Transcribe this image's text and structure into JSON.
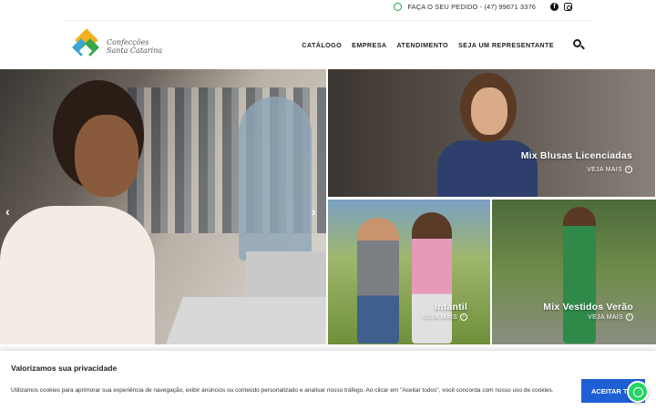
{
  "topbar": {
    "order_text": "FAÇA O SEU PEDIDO - (47) 99671 3376",
    "icons": [
      "whatsapp-icon",
      "facebook-icon",
      "instagram-icon"
    ]
  },
  "header": {
    "logo": {
      "line1": "Confecções",
      "line2": "Santa Catarina"
    },
    "nav": [
      {
        "label": "CATÁLOGO"
      },
      {
        "label": "EMPRESA"
      },
      {
        "label": "ATENDIMENTO"
      },
      {
        "label": "SEJA UM REPRESENTANTE"
      }
    ],
    "search_icon": "search-icon"
  },
  "hero": {
    "prev_arrow": "‹",
    "next_arrow": "›"
  },
  "tiles": [
    {
      "title": "Mix Blusas Licenciadas",
      "more": "VEJA MAIS"
    },
    {
      "title": "Infantil",
      "more": "VEJA MAIS"
    },
    {
      "title": "Mix Vestidos Verão",
      "more": "VEJA MAIS"
    }
  ],
  "cookie": {
    "title": "Valorizamos sua privacidade",
    "text": "Utilizamos cookies para aprimorar sua experiência de navegação, exibir anúncios ou conteúdo personalizado e analisar nosso tráfego. Ao clicar em \"Aceitar todos\", você concorda com nosso uso de cookies.",
    "accept_label": "ACEITAR TUDO"
  },
  "colors": {
    "accent_button": "#1f5fd6",
    "whatsapp": "#25d366"
  }
}
